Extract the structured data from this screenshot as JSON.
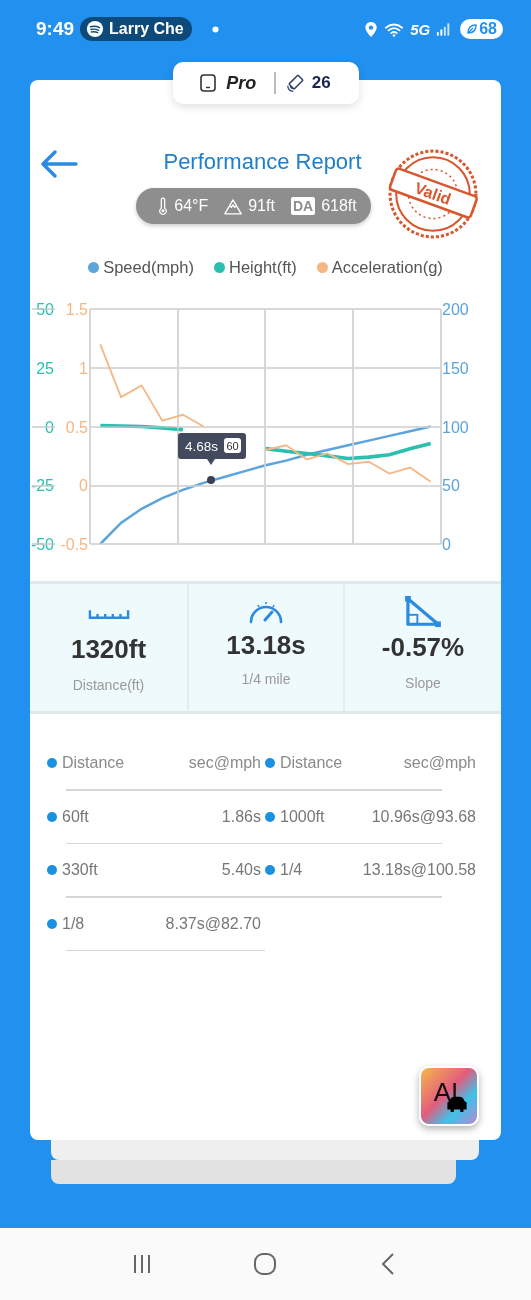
{
  "status_bar": {
    "time": "9:49",
    "media": "Larry Che",
    "network": "5G",
    "battery": "68"
  },
  "device_pill": {
    "tier": "Pro",
    "satellites": "26"
  },
  "header": {
    "title": "Performance Report",
    "stamp": "Valid"
  },
  "conditions": [
    {
      "kind": "temperature",
      "text": "64°F"
    },
    {
      "kind": "altitude",
      "text": "91ft"
    },
    {
      "kind": "density",
      "badge": "DA",
      "text": "618ft"
    }
  ],
  "chart": {
    "layers": [
      {
        "chart_data": {
          "type": "line",
          "grid": true,
          "ylim": [
            0,
            200
          ],
          "yticks": [
            200,
            150,
            100,
            50,
            0
          ],
          "series": [
            {
              "name": "Speed(mph)",
              "color": "#5ba4dc",
              "values": [
                0,
                18,
                30,
                39,
                46,
                52,
                57,
                62,
                67,
                71,
                76,
                80,
                84,
                88,
                92,
                96,
                100
              ]
            }
          ]
        }
      },
      {
        "chart_data": {
          "type": "line",
          "grid": true,
          "ylim": [
            -50,
            50
          ],
          "yticks": [
            50,
            25,
            0,
            -25,
            -50
          ],
          "series": [
            {
              "name": "Height(ft)",
              "color": "#2bbfb0",
              "values": [
                0.4,
                0.2,
                0,
                -0.6,
                -1.3,
                null,
                null,
                null,
                -9.4,
                -10.5,
                -11.5,
                -12.5,
                -13.6,
                -13,
                -12,
                -9.5,
                -7.2
              ]
            }
          ]
        }
      },
      {
        "chart_data": {
          "type": "line",
          "grid": true,
          "ylim": [
            -0.5,
            1.5
          ],
          "yticks": [
            1.5,
            1,
            0.5,
            0,
            -0.5
          ],
          "series": [
            {
              "name": "Acceleration(g)",
              "color": "#f5b784",
              "values": [
                1.2,
                0.75,
                0.85,
                0.55,
                0.6,
                0.5,
                null,
                null,
                0.3,
                0.34,
                0.22,
                0.27,
                0.18,
                0.2,
                0.1,
                0.15,
                0.03
              ]
            }
          ]
        }
      }
    ]
  },
  "tooltip": {
    "time": "4.68s",
    "speed": "60"
  },
  "stats": [
    {
      "kind": "distance",
      "value": "1320ft",
      "label": "Distance(ft)"
    },
    {
      "kind": "time",
      "value": "13.18s",
      "label": "1/4 mile"
    },
    {
      "kind": "slope",
      "value": "-0.57%",
      "label": "Slope"
    }
  ],
  "splits": [
    {
      "cells": [
        {
          "kind": "header",
          "label": "Distance",
          "value": "sec@mph"
        },
        {
          "kind": "header",
          "label": "Distance",
          "value": "sec@mph"
        }
      ]
    },
    {
      "cells": [
        {
          "kind": "split",
          "label": "60ft",
          "value": "1.86s"
        },
        {
          "kind": "split",
          "label": "1000ft",
          "value": "10.96s@93.68"
        }
      ]
    },
    {
      "cells": [
        {
          "kind": "split",
          "label": "330ft",
          "value": "5.40s"
        },
        {
          "kind": "split",
          "label": "1/4",
          "value": "13.18s@100.58"
        }
      ]
    },
    {
      "cells": [
        {
          "kind": "split",
          "label": "1/8",
          "value": "8.37s@82.70"
        }
      ]
    }
  ],
  "ai_button": {
    "label": "AI"
  }
}
